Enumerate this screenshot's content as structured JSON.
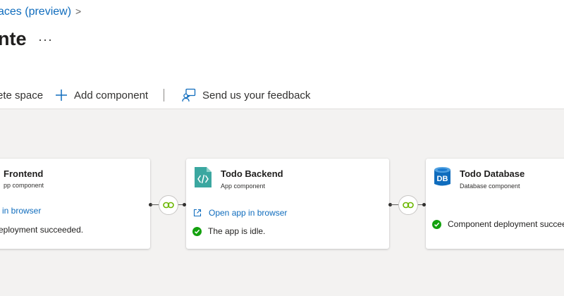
{
  "breadcrumb": {
    "text": "aces (preview)",
    "chevron": ">"
  },
  "header": {
    "title": "nte",
    "more": "···"
  },
  "toolbar": {
    "delete_label": "ete space",
    "add_label": "Add component",
    "feedback_label": "Send us your feedback",
    "separator": "|"
  },
  "components": [
    {
      "title": "Frontend",
      "subtitle": "pp component",
      "link": "in browser",
      "status": "eployment succeeded."
    },
    {
      "title": "Todo Backend",
      "subtitle": "App component",
      "link": "Open app in browser",
      "status": "The app is idle."
    },
    {
      "title": "Todo Database",
      "subtitle": "Database component",
      "icon_text": "DB",
      "status": "Component deployment succeede"
    }
  ],
  "colors": {
    "accent": "#0f6cbd",
    "success": "#13a10e",
    "connector": "#6bb700",
    "canvas": "#f3f2f1"
  },
  "icons": [
    "add-icon",
    "feedback-icon",
    "app-service-icon",
    "database-icon",
    "open-external-icon",
    "check-circle-icon",
    "link-icon"
  ]
}
